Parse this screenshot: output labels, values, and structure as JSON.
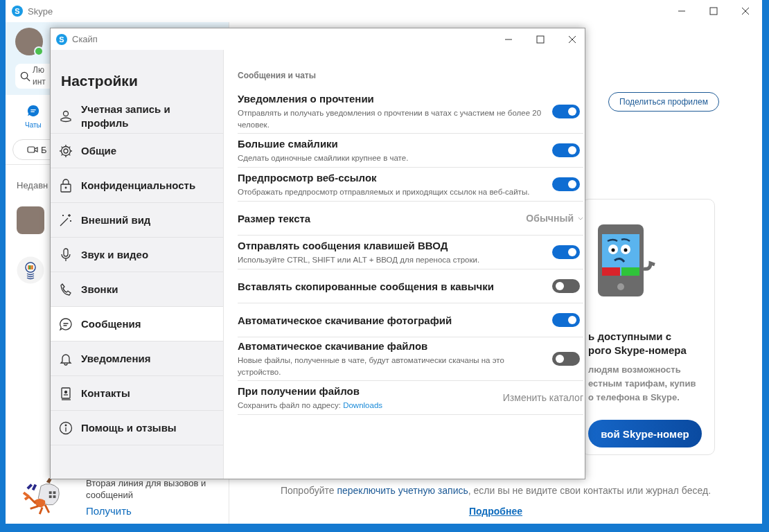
{
  "main_window": {
    "logo_letter": "S",
    "title": "Skype",
    "profile": {
      "online": true
    },
    "search": {
      "placeholder": "Лю\nинт"
    },
    "nav_tabs": [
      {
        "label": "Чаты",
        "selected": true
      }
    ],
    "meet_button": {
      "label": "Б"
    },
    "recent_heading": "Недавн",
    "share_button": "Поделиться профилем",
    "promo_card": {
      "title_lines": [
        "ь доступными с",
        "рого Skype-номера"
      ],
      "body_lines": [
        "людям возможность",
        "естным тарифам, купив",
        "о телефона в Skype."
      ],
      "button": "вой Skype-номер"
    },
    "footer": {
      "text_before": "Попробуйте",
      "link": "переключить учетную запись",
      "text_after": ", если вы не видите свои контакты или журнал бесед.",
      "more_link": "Подробнее"
    },
    "bottom_promo": {
      "text": "Вторая линия для вызовов и сообщений",
      "link": "Получить"
    }
  },
  "settings_dialog": {
    "logo_letter": "S",
    "title": "Скайп",
    "heading": "Настройки",
    "menu": [
      {
        "label": "Учетная запись и профиль",
        "selected": false
      },
      {
        "label": "Общие",
        "selected": false
      },
      {
        "label": "Конфиденциальность",
        "selected": false
      },
      {
        "label": "Внешний вид",
        "selected": false
      },
      {
        "label": "Звук и видео",
        "selected": false
      },
      {
        "label": "Звонки",
        "selected": false
      },
      {
        "label": "Сообщения",
        "selected": true
      },
      {
        "label": "Уведомления",
        "selected": false
      },
      {
        "label": "Контакты",
        "selected": false
      },
      {
        "label": "Помощь и отзывы",
        "selected": false
      }
    ],
    "section_title": "Сообщения и чаты",
    "settings": [
      {
        "kind": "toggle",
        "title": "Уведомления о прочтении",
        "description": "Отправлять и получать уведомления о прочтении в чатах с участием не более 20 человек.",
        "on": true
      },
      {
        "kind": "toggle",
        "title": "Большие смайлики",
        "description": "Сделать одиночные смайлики крупнее в чате.",
        "on": true
      },
      {
        "kind": "toggle",
        "title": "Предпросмотр веб-ссылок",
        "description": "Отображать предпросмотр отправляемых и приходящих ссылок на веб-сайты.",
        "on": true
      },
      {
        "kind": "select",
        "title": "Размер текста",
        "value": "Обычный"
      },
      {
        "kind": "toggle",
        "title": "Отправлять сообщения клавишей ВВОД",
        "description": "Используйте CTRL, SHIFT или ALT + ВВОД для переноса строки.",
        "on": true
      },
      {
        "kind": "toggle",
        "title": "Вставлять скопированные сообщения в кавычки",
        "on": false
      },
      {
        "kind": "toggle",
        "title": "Автоматическое скачивание фотографий",
        "on": true
      },
      {
        "kind": "toggle",
        "title": "Автоматическое скачивание файлов",
        "description": "Новые файлы, полученные в чате, будут автоматически скачаны на это устройство.",
        "on": false
      },
      {
        "kind": "folder",
        "title": "При получении файлов",
        "description": "Сохранить файл по адресу:",
        "link": "Downloads",
        "action": "Изменить каталог"
      }
    ]
  }
}
